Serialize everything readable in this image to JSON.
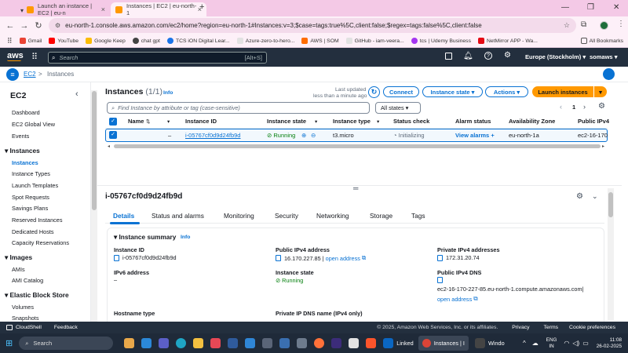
{
  "browser": {
    "tabs": [
      {
        "title": "Launch an instance | EC2 | eu-n",
        "active": false
      },
      {
        "title": "Instances | EC2 | eu-north-1",
        "active": true
      }
    ],
    "new_tab": "+",
    "url": "eu-north-1.console.aws.amazon.com/ec2/home?region=eu-north-1#Instances:v=3;$case=tags:true%5C,client:false;$regex=tags:false%5C,client:false",
    "bookmarks": [
      {
        "label": "Gmail",
        "color": "#ea4335"
      },
      {
        "label": "YouTube",
        "color": "#ff0000"
      },
      {
        "label": "Google Keep",
        "color": "#fbbc04"
      },
      {
        "label": "chat gpt",
        "color": "#444444"
      },
      {
        "label": "TCS iON Digital Lear...",
        "color": "#1a73e8"
      },
      {
        "label": "Azure-zero-to-hero...",
        "color": "#e2e2e2"
      },
      {
        "label": "AWS | SOM",
        "color": "#ff6d00"
      },
      {
        "label": "GitHub - iam-veera...",
        "color": "#24292f"
      },
      {
        "label": "tcs | Udemy Business",
        "color": "#a435f0"
      },
      {
        "label": "NetMirror APP - Wa...",
        "color": "#e50914"
      }
    ],
    "all_bookmarks": "All Bookmarks"
  },
  "aws_header": {
    "logo": "aws",
    "search_placeholder": "Search",
    "search_shortcut": "[Alt+S]",
    "region": "Europe (Stockholm)",
    "user": "somaws"
  },
  "breadcrumb": {
    "root": "EC2",
    "separator": ">",
    "current": "Instances"
  },
  "sidebar": {
    "title": "EC2",
    "items_top": [
      "Dashboard",
      "EC2 Global View",
      "Events"
    ],
    "section_instances": "Instances",
    "instances_items": [
      "Instances",
      "Instance Types",
      "Launch Templates",
      "Spot Requests",
      "Savings Plans",
      "Reserved Instances",
      "Dedicated Hosts",
      "Capacity Reservations"
    ],
    "section_images": "Images",
    "images_items": [
      "AMIs",
      "AMI Catalog"
    ],
    "section_ebs": "Elastic Block Store",
    "ebs_items": [
      "Volumes",
      "Snapshots"
    ]
  },
  "instances_panel": {
    "title": "Instances",
    "count": "(1/1)",
    "info": "Info",
    "last_updated_line1": "Last updated",
    "last_updated_line2": "less than a minute ago",
    "connect": "Connect",
    "instance_state": "Instance state",
    "actions": "Actions",
    "launch": "Launch instances",
    "filter_placeholder": "Find Instance by attribute or tag (case-sensitive)",
    "states_filter": "All states",
    "page": "1",
    "columns": [
      "Name",
      "Instance ID",
      "Instance state",
      "Instance type",
      "Status check",
      "Alarm status",
      "Availability Zone",
      "Public IPv4"
    ],
    "row": {
      "name": "–",
      "id": "i-05767cf0d9d24fb9d",
      "state": "Running",
      "type": "t3.micro",
      "status": "Initializing",
      "alarm": "View alarms",
      "alarm_plus": "+",
      "az": "eu-north-1a",
      "ipv4": "ec2-16-170"
    }
  },
  "details": {
    "instance_id": "i-05767cf0d9d24fb9d",
    "tabs": [
      "Details",
      "Status and alarms",
      "Monitoring",
      "Security",
      "Networking",
      "Storage",
      "Tags"
    ],
    "summary_title": "Instance summary",
    "summary_info": "Info",
    "fields": {
      "instance_id_label": "Instance ID",
      "instance_id_value": "i-05767cf0d9d24fb9d",
      "ipv6_label": "IPv6 address",
      "ipv6_value": "–",
      "hostname_label": "Hostname type",
      "public_ipv4_label": "Public IPv4 address",
      "public_ipv4_value": "16.170.227.85",
      "public_ipv4_sep": "|",
      "open_address": "open address",
      "state_label": "Instance state",
      "state_value": "Running",
      "private_dns_label": "Private IP DNS name (IPv4 only)",
      "private_ipv4_label": "Private IPv4 addresses",
      "private_ipv4_value": "172.31.20.74",
      "public_dns_label": "Public IPv4 DNS",
      "public_dns_value": "ec2-16-170-227-85.eu-north-1.compute.amazonaws.com",
      "public_dns_sep": "|",
      "public_dns_open": "open address"
    }
  },
  "footer": {
    "cloudshell": "CloudShell",
    "feedback": "Feedback",
    "copyright": "© 2025, Amazon Web Services, Inc. or its affiliates.",
    "privacy": "Privacy",
    "terms": "Terms",
    "cookies": "Cookie preferences"
  },
  "taskbar": {
    "search": "Search",
    "linked": "Linked",
    "chrome_label": "Instances | I",
    "terminal_label": "Windo",
    "lang1": "ENG",
    "lang2": "IN",
    "time": "11:08",
    "date": "26-02-2025"
  },
  "colors": {
    "aws_dark": "#232f3e",
    "link": "#0972d3",
    "accent": "#ff9900",
    "running": "#037f0c",
    "browser_tab": "#f4c9e6"
  }
}
